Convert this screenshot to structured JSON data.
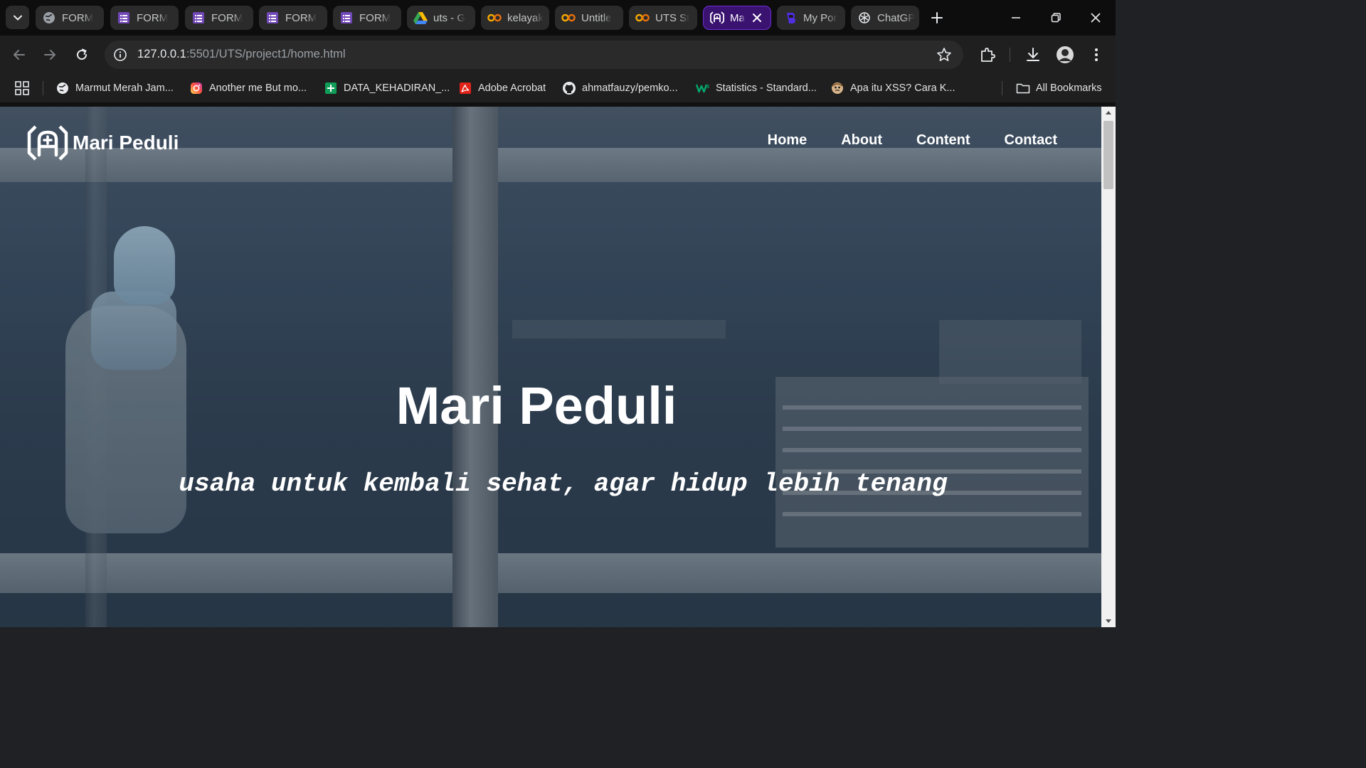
{
  "browser": {
    "tabs": [
      {
        "label": "FORM",
        "icon": "globe-icon"
      },
      {
        "label": "FORM",
        "icon": "forms-icon"
      },
      {
        "label": "FORM",
        "icon": "forms-icon"
      },
      {
        "label": "FORM",
        "icon": "forms-icon"
      },
      {
        "label": "FORM",
        "icon": "forms-icon"
      },
      {
        "label": "uts - G",
        "icon": "drive-icon"
      },
      {
        "label": "kelayak",
        "icon": "colab-icon"
      },
      {
        "label": "Untitle",
        "icon": "colab-icon"
      },
      {
        "label": "UTS St",
        "icon": "colab-icon"
      },
      {
        "label": "Ma",
        "icon": "site-logo-icon",
        "active": true
      },
      {
        "label": "My Por",
        "icon": "bootstrap-icon"
      },
      {
        "label": "ChatGP",
        "icon": "chatgpt-icon"
      }
    ],
    "address": {
      "host": "127.0.0.1",
      "rest": ":5501/UTS/project1/home.html"
    },
    "bookmarks": [
      {
        "label": "Marmut Merah Jam...",
        "icon": "globe-icon"
      },
      {
        "label": "Another me But mo...",
        "icon": "instagram-icon"
      },
      {
        "label": "DATA_KEHADIRAN_...",
        "icon": "sheets-icon"
      },
      {
        "label": "Adobe Acrobat",
        "icon": "acrobat-icon"
      },
      {
        "label": "ahmatfauzy/pemko...",
        "icon": "github-icon"
      },
      {
        "label": "Statistics - Standard...",
        "icon": "w3-icon"
      },
      {
        "label": "Apa itu XSS? Cara K...",
        "icon": "face-icon"
      }
    ],
    "all_bookmarks_label": "All Bookmarks",
    "colors": {
      "active_tab": "#3a1270",
      "active_tab_border": "#6f2fd6"
    }
  },
  "page": {
    "logo_text": "Mari Peduli",
    "nav": [
      "Home",
      "About",
      "Content",
      "Contact"
    ],
    "hero_title": "Mari Peduli",
    "hero_subtitle": "usaha untuk kembali sehat, agar hidup lebih tenang"
  }
}
